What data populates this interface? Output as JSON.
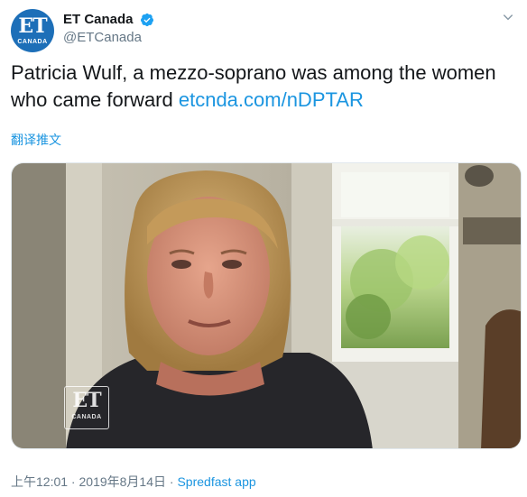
{
  "account": {
    "avatar_text": "ET",
    "avatar_subtext": "CANADA",
    "display_name": "ET Canada",
    "handle": "@ETCanada",
    "verified_icon": "verified-badge-icon",
    "verified_color": "#1da1f2"
  },
  "tweet": {
    "text": "Patricia Wulf, a mezzo-soprano was among the women who came forward ",
    "link": "etcnda.com/nDPTAR",
    "link_color": "#1b95e0"
  },
  "translate_label": "翻译推文",
  "media": {
    "watermark_text": "ET",
    "watermark_subtext": "CANADA"
  },
  "footer": {
    "time": "上午12:01",
    "separator": " · ",
    "date": "2019年8月14日",
    "separator2": " · ",
    "source": "Spredfast app"
  },
  "icons": {
    "chevron": "chevron-down-icon"
  }
}
